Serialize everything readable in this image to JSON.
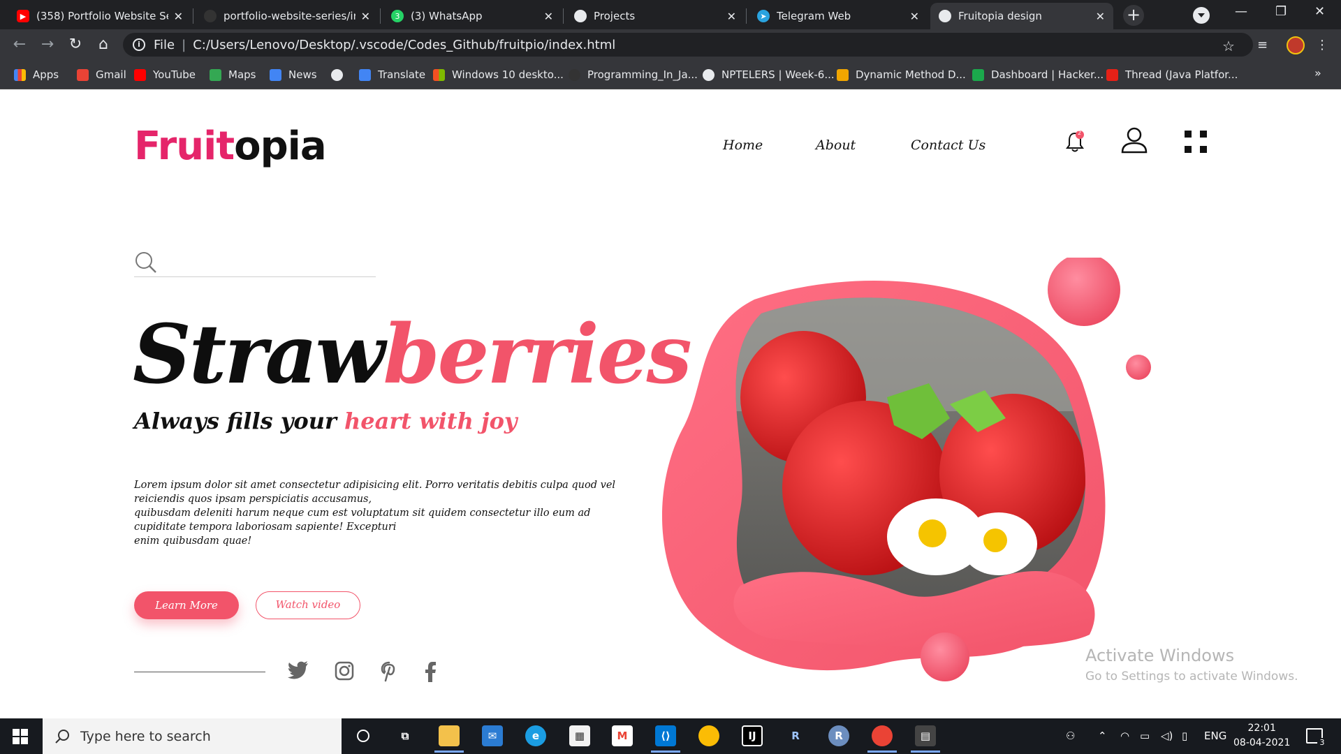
{
  "browser": {
    "tabs": [
      {
        "label": "(358) Portfolio Website Serie",
        "icon": "youtube-icon",
        "color": "#ff0000"
      },
      {
        "label": "portfolio-website-series/ind",
        "icon": "github-icon",
        "color": "#333333"
      },
      {
        "label": "(3) WhatsApp",
        "icon": "whatsapp-icon",
        "color": "#25d366"
      },
      {
        "label": "Projects",
        "icon": "globe-icon",
        "color": "#e8eaed"
      },
      {
        "label": "Telegram Web",
        "icon": "telegram-icon",
        "color": "#2aa3df"
      },
      {
        "label": "Fruitopia design",
        "icon": "globe-icon",
        "color": "#e8eaed"
      }
    ],
    "url_scheme": "File",
    "url": "C:/Users/Lenovo/Desktop/.vscode/Codes_Github/fruitpio/index.html",
    "bookmarks": [
      {
        "label": "Apps",
        "icon": "apps-grid-icon",
        "color": "#4285f4"
      },
      {
        "label": "Gmail",
        "icon": "gmail-icon",
        "color": "#ea4335"
      },
      {
        "label": "YouTube",
        "icon": "youtube-icon",
        "color": "#ff0000"
      },
      {
        "label": "Maps",
        "icon": "maps-icon",
        "color": "#34a853"
      },
      {
        "label": "News",
        "icon": "news-icon",
        "color": "#4285f4"
      },
      {
        "label": "",
        "icon": "globe-icon",
        "color": "#e8eaed"
      },
      {
        "label": "Translate",
        "icon": "translate-icon",
        "color": "#4285f4"
      },
      {
        "label": "Windows 10 deskto...",
        "icon": "windows-icon",
        "color": "#f25022"
      },
      {
        "label": "Programming_In_Ja...",
        "icon": "github-icon",
        "color": "#333333"
      },
      {
        "label": "NPTELERS | Week-6...",
        "icon": "globe-icon",
        "color": "#e8eaed"
      },
      {
        "label": "Dynamic Method D...",
        "icon": "geeks-icon",
        "color": "#f0a500"
      },
      {
        "label": "Dashboard | Hacker...",
        "icon": "hackerrank-icon",
        "color": "#1ba94c"
      },
      {
        "label": "Thread (Java Platfor...",
        "icon": "oracle-icon",
        "color": "#e62117"
      }
    ]
  },
  "site": {
    "logo_part1": "Fruit",
    "logo_part2": "opia",
    "nav": [
      "Home",
      "About",
      "Contact Us"
    ],
    "notification_count": "2",
    "headline_part1": "Straw",
    "headline_part2": "berries",
    "tagline_part1": "Always fills your",
    "tagline_part2": "heart with joy",
    "lorem_line1": "Lorem ipsum dolor sit amet consectetur adipisicing elit. Porro veritatis debitis culpa quod vel reiciendis quos ipsam perspiciatis accusamus,",
    "lorem_line2": "quibusdam deleniti harum neque cum est voluptatum sit quidem consectetur illo eum ad cupiditate tempora laboriosam sapiente! Excepturi",
    "lorem_line3": "enim quibusdam quae!",
    "btn_learn": "Learn More",
    "btn_watch": "Watch video",
    "social": [
      "twitter-icon",
      "instagram-icon",
      "pinterest-icon",
      "facebook-icon"
    ],
    "accent_color": "#f2546a",
    "logo_color": "#e5256a"
  },
  "watermark": {
    "line1": "Activate Windows",
    "line2": "Go to Settings to activate Windows."
  },
  "taskbar": {
    "search_placeholder": "Type here to search",
    "language": "ENG",
    "time": "22:01",
    "date": "08-04-2021",
    "notification_badge": "3"
  }
}
